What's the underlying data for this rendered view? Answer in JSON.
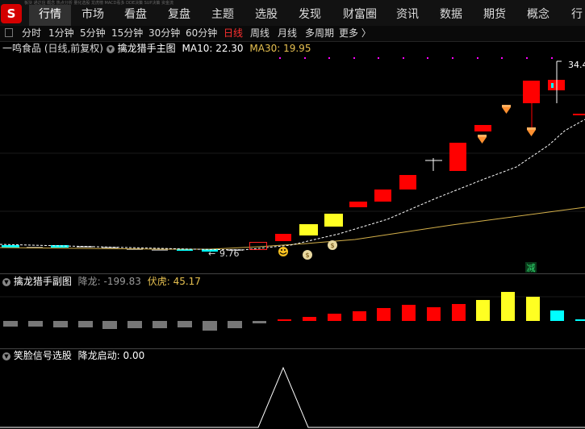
{
  "app": {
    "logo_text": "S",
    "tiny_toolbar": "板块 通达信 概念 热点分析 量化选股 龙虎榜 MACD看多 DDE决策 SUP决策 资金流"
  },
  "nav": {
    "tabs": [
      "行情",
      "市场",
      "看盘",
      "复盘",
      "主题",
      "选股",
      "发现",
      "财富圈",
      "资讯",
      "数据",
      "期货",
      "概念",
      "行"
    ],
    "active": "行情"
  },
  "periods": {
    "items": [
      "分时",
      "1分钟",
      "5分钟",
      "15分钟",
      "30分钟",
      "60分钟",
      "日线",
      "周线",
      "月线",
      "多周期",
      "更多 〉"
    ],
    "active": "日线"
  },
  "main_panel": {
    "stock": "一鸣食品 (日线,前复权)",
    "indicator": "擒龙猎手主图",
    "ma10_label": "MA10:",
    "ma10_value": "22.30",
    "ma30_label": "MA30:",
    "ma30_value": "19.95",
    "high_label": "34.4",
    "low_label": "9.76",
    "marker_text": "减"
  },
  "sub_panel": {
    "title": "擒龙猎手副图",
    "label1": "降龙:",
    "value1": "-199.83",
    "label2": "伏虎:",
    "value2": "45.17"
  },
  "bottom_panel": {
    "title": "笑脸信号选股",
    "label": "降龙启动:",
    "value": "0.00"
  },
  "colors": {
    "up": "#ff0000",
    "down": "#00ffff",
    "yellow": "#ffff00",
    "gray": "#777777",
    "ma10": "#ffffff",
    "ma30": "#d4b04a",
    "magenta": "#ff00ff"
  }
}
